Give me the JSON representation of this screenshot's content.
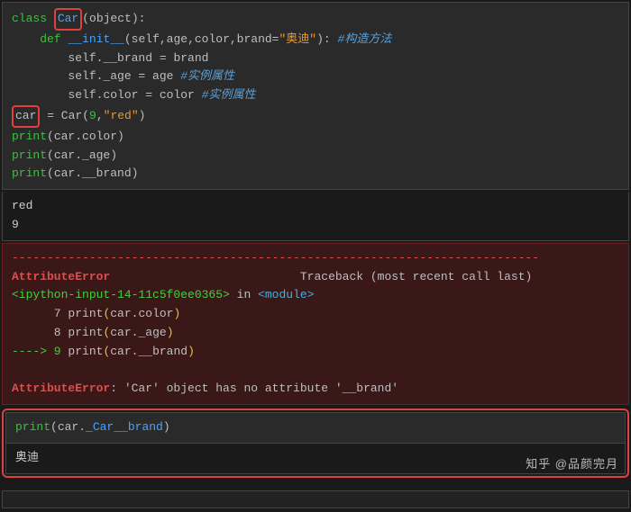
{
  "cell1": {
    "t": {
      "class": "class ",
      "car": "Car",
      "obj": "(object):",
      "def": "def ",
      "init": "__init__",
      "params1": "(self,age,color,brand=",
      "defstr": "\"奥迪\"",
      "params2": "): ",
      "cmt1": "#构造方法",
      "l3a": "self.__brand = brand",
      "l4a": "self._age = age ",
      "cmt4": "#实例属性",
      "l5a": "self.color = color ",
      "cmt5": "#实例属性",
      "carvar": "car",
      "assign": " = Car(",
      "nine": "9",
      "comma": ",",
      "red": "\"red\"",
      "close": ")",
      "p1": "print",
      "p1a": "(car.color)",
      "p2": "print",
      "p2a": "(car._age)",
      "p3": "print",
      "p3a": "(car.__brand)"
    }
  },
  "out1": {
    "l1": "red",
    "l2": "9"
  },
  "err": {
    "dashes": "---------------------------------------------------------------------------",
    "name": "AttributeError",
    "tb": "Traceback (most recent call last)",
    "src": "<ipython-input-14-11c5f0ee0365>",
    "in": " in ",
    "mod": "<module>",
    "n7": "      7 ",
    "l7a": "print",
    "l7b": "(",
    "l7c": "car",
    "l7d": ".",
    "l7e": "color",
    "l7f": ")",
    "n8": "      8 ",
    "l8a": "print",
    "l8b": "(",
    "l8c": "car",
    "l8d": ".",
    "l8e": "_age",
    "l8f": ")",
    "arrow": "----> 9 ",
    "l9a": "print",
    "l9b": "(",
    "l9c": "car",
    "l9d": ".",
    "l9e": "__brand",
    "l9f": ")",
    "name2": "AttributeError",
    "colon": ": ",
    "msg": "'Car' object has no attribute '__brand'"
  },
  "cell2": {
    "p": "print",
    "open": "(car.",
    "attr": "_Car__brand",
    "close": ")"
  },
  "out2": {
    "l1": "奥迪"
  },
  "watermark": "知乎 @品颜完月"
}
